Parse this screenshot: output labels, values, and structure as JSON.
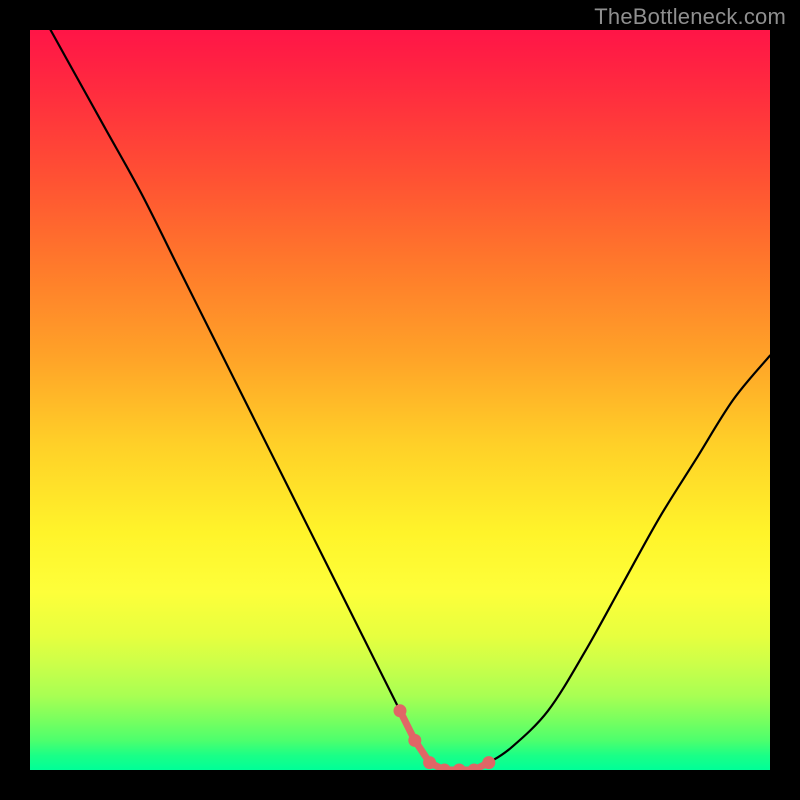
{
  "watermark": "TheBottleneck.com",
  "colors": {
    "frame": "#000000",
    "curve": "#000000",
    "marker": "#e06666",
    "rainbow_top": "#ff1547",
    "rainbow_bottom": "#00ff98"
  },
  "chart_data": {
    "type": "line",
    "title": "",
    "xlabel": "",
    "ylabel": "",
    "xlim": [
      0,
      100
    ],
    "ylim": [
      0,
      100
    ],
    "x": [
      0,
      5,
      10,
      15,
      20,
      25,
      30,
      35,
      40,
      45,
      50,
      52,
      54,
      56,
      58,
      60,
      62,
      65,
      70,
      75,
      80,
      85,
      90,
      95,
      100
    ],
    "y": [
      105,
      96,
      87,
      78,
      68,
      58,
      48,
      38,
      28,
      18,
      8,
      4,
      1,
      0,
      0,
      0,
      1,
      3,
      8,
      16,
      25,
      34,
      42,
      50,
      56
    ],
    "markers": {
      "x": [
        50,
        52,
        54,
        56,
        58,
        60,
        62
      ],
      "y": [
        8,
        4,
        1,
        0,
        0,
        0,
        1
      ]
    }
  }
}
